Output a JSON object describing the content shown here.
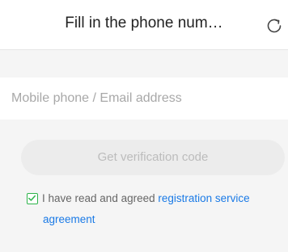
{
  "header": {
    "title": "Fill in the phone num…",
    "refresh_icon": "refresh-icon"
  },
  "form": {
    "account_placeholder": "Mobile phone / Email address",
    "account_value": "",
    "verify_button_label": "Get verification code"
  },
  "agreement": {
    "checked": true,
    "text": "I have read and agreed",
    "link_part1": "registration service",
    "link_part2": "agreement"
  },
  "colors": {
    "background": "#f5f5f5",
    "checkbox_green": "#2db34a",
    "link_blue": "#1a7ae6",
    "disabled_button_bg": "#ececec",
    "disabled_button_text": "#bcbcbc"
  }
}
